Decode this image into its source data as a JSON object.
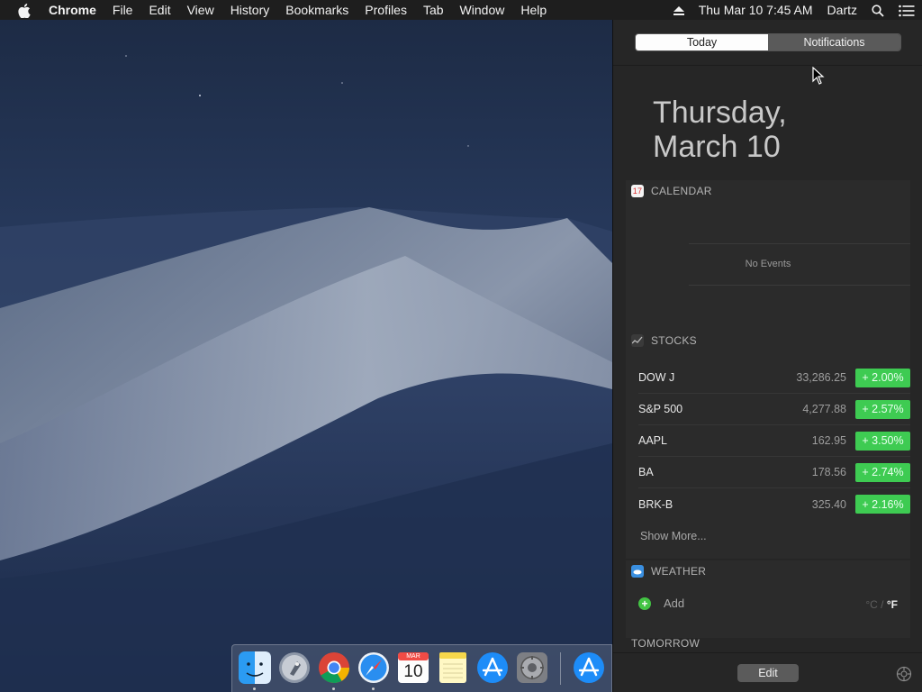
{
  "menubar": {
    "app_name": "Chrome",
    "items": [
      "File",
      "Edit",
      "View",
      "History",
      "Bookmarks",
      "Profiles",
      "Tab",
      "Window",
      "Help"
    ],
    "datetime": "Thu Mar 10  7:45 AM",
    "user": "Dartz"
  },
  "notification_center": {
    "tabs": {
      "today": "Today",
      "notifications": "Notifications"
    },
    "date_line1": "Thursday,",
    "date_line2": "March 10",
    "calendar": {
      "title": "CALENDAR",
      "icon_text": "17",
      "empty_text": "No Events"
    },
    "stocks": {
      "title": "STOCKS",
      "rows": [
        {
          "symbol": "DOW J",
          "price": "33,286.25",
          "change": "+ 2.00%"
        },
        {
          "symbol": "S&P 500",
          "price": "4,277.88",
          "change": "+ 2.57%"
        },
        {
          "symbol": "AAPL",
          "price": "162.95",
          "change": "+ 3.50%"
        },
        {
          "symbol": "BA",
          "price": "178.56",
          "change": "+ 2.74%"
        },
        {
          "symbol": "BRK-B",
          "price": "325.40",
          "change": "+ 2.16%"
        }
      ],
      "show_more": "Show More..."
    },
    "weather": {
      "title": "WEATHER",
      "add_label": "Add",
      "unit_c": "°C",
      "unit_sep": "/",
      "unit_f": "°F"
    },
    "tomorrow": {
      "title": "TOMORROW"
    },
    "edit_label": "Edit"
  },
  "dock": {
    "calendar_month": "MAR",
    "calendar_day": "10"
  },
  "colors": {
    "stock_up": "#3ecb52",
    "panel_bg": "#262626",
    "menubar_bg": "#1e1e1e"
  }
}
